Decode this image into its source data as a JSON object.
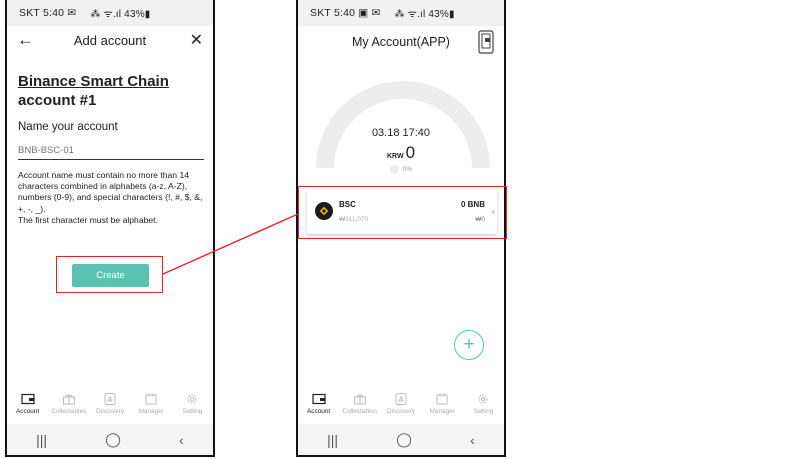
{
  "colors": {
    "accent": "#5cc2b0",
    "highlight": "#e0262a",
    "bnb": "#f0b90b"
  },
  "left": {
    "status": {
      "text": "SKT 5:40 ✉",
      "icons": "⁂ ᯤ.ıl 43%▮"
    },
    "header": {
      "title": "Add account",
      "back_icon": "arrow-left-icon",
      "close_icon": "close-icon"
    },
    "account_title": {
      "chain": "Binance Smart Chain",
      "rest": " account #1"
    },
    "name_label": "Name your account",
    "name_input_placeholder": "BNB-BSC-01",
    "rules": [
      "Account name must contain no more than 14 characters combined in alphabets (a-z, A-Z), numbers (0-9), and special characters (!, #, $, &, +, -, _).",
      "The first character must be alphabet."
    ],
    "create_button": "Create",
    "tabs": [
      "Account",
      "Collectables",
      "Discovery",
      "Manager",
      "Setting"
    ],
    "active_tab": "Account",
    "nav": {
      "recent": "|||",
      "home": "◯",
      "back": "‹"
    }
  },
  "right": {
    "status": {
      "text": "SKT 5:40 ▣ ✉",
      "icons": "⁂ ᯤ.ıl 43%▮"
    },
    "header": {
      "title": "My Account(APP)",
      "wallet_icon": "hardware-wallet-icon"
    },
    "gauge": {
      "time": "03.18 17:40",
      "currency": "KRW",
      "amount": "0",
      "percent": "0%"
    },
    "asset": {
      "symbol": "BSC",
      "fiat": "₩311,070",
      "amount": "0 BNB",
      "fiat_amount": "₩0",
      "icon": "bnb-logo-icon"
    },
    "fab_label": "+",
    "tabs": [
      "Account",
      "Collectables",
      "Discovery",
      "Manager",
      "Setting"
    ],
    "active_tab": "Account",
    "nav": {
      "recent": "|||",
      "home": "◯",
      "back": "‹"
    }
  }
}
